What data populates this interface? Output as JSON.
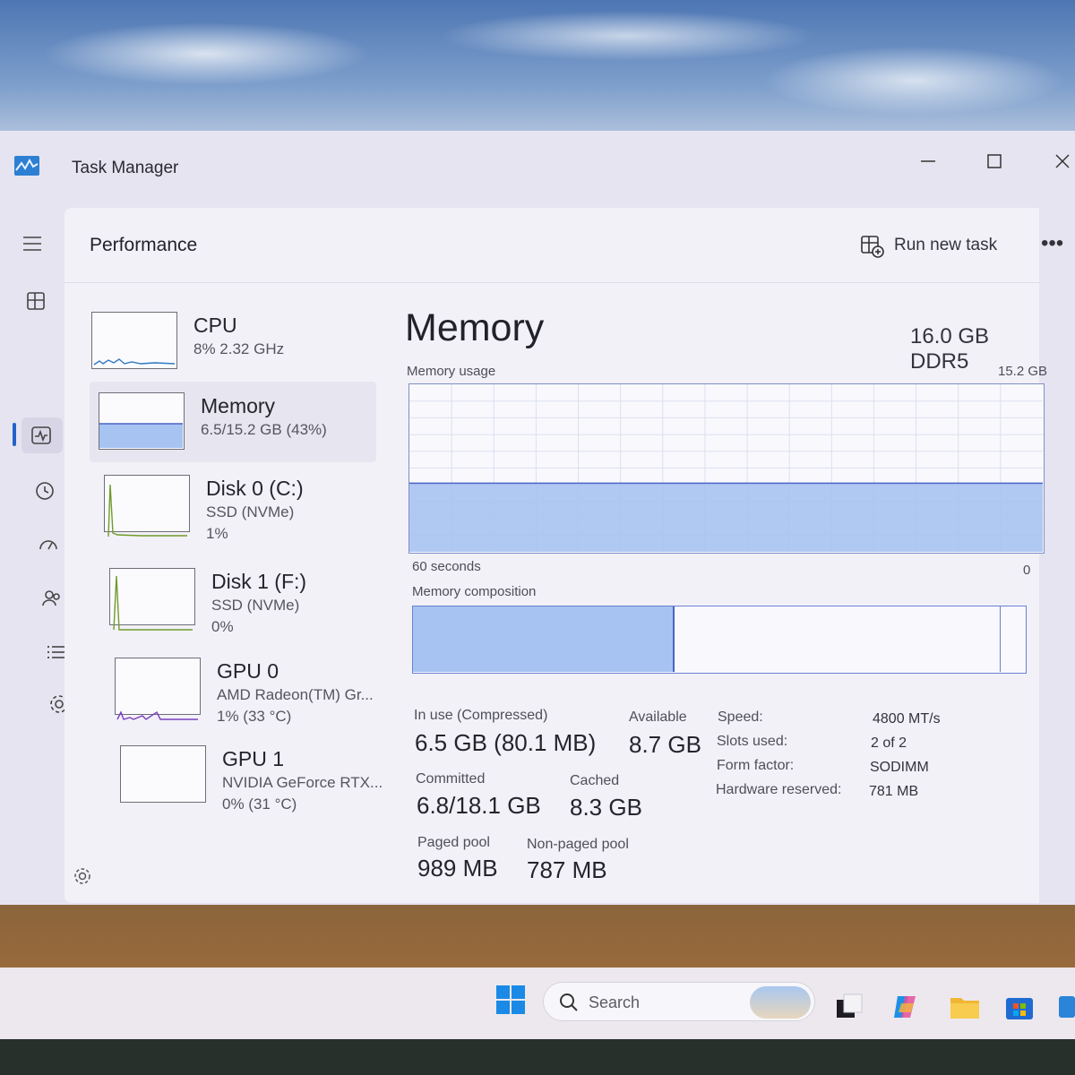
{
  "window": {
    "title": "Task Manager",
    "minimize_icon": "minimize-icon",
    "maximize_icon": "maximize-icon",
    "close_icon": "close-icon"
  },
  "nav": {
    "items": [
      {
        "icon": "hamburger-menu-icon"
      },
      {
        "icon": "processes-icon"
      },
      {
        "icon": "performance-icon",
        "active": true
      },
      {
        "icon": "app-history-icon"
      },
      {
        "icon": "startup-apps-icon"
      },
      {
        "icon": "users-icon"
      },
      {
        "icon": "details-icon"
      },
      {
        "icon": "services-icon"
      }
    ],
    "settings_icon": "settings-icon"
  },
  "header": {
    "title": "Performance",
    "run_new_task": "Run new task",
    "more": "•••"
  },
  "devices": [
    {
      "name": "CPU",
      "line1": "8% 2.32 GHz",
      "line2": "",
      "color": "#2f78c2"
    },
    {
      "name": "Memory",
      "line1": "6.5/15.2 GB (43%)",
      "line2": "",
      "color": "#5f73c9",
      "selected": true
    },
    {
      "name": "Disk 0 (C:)",
      "line1": "SSD (NVMe)",
      "line2": "1%",
      "color": "#6f9b2a"
    },
    {
      "name": "Disk 1 (F:)",
      "line1": "SSD (NVMe)",
      "line2": "0%",
      "color": "#6f9b2a"
    },
    {
      "name": "GPU 0",
      "line1": "AMD Radeon(TM) Gr...",
      "line2": "1% (33 °C)",
      "color": "#7a3fbf"
    },
    {
      "name": "GPU 1",
      "line1": "NVIDIA GeForce RTX...",
      "line2": "0% (31 °C)",
      "color": "#7a3fbf"
    }
  ],
  "memory": {
    "title": "Memory",
    "total": "16.0 GB DDR5",
    "usage_label": "Memory usage",
    "usage_max": "15.2 GB",
    "time_label": "60 seconds",
    "time_end": "0",
    "composition_label": "Memory composition",
    "usage_fraction": 0.41,
    "composition": {
      "in_use_fraction": 0.427,
      "standby_fraction": 0.96
    },
    "stats": {
      "in_use_label": "In use (Compressed)",
      "in_use_value": "6.5 GB (80.1 MB)",
      "available_label": "Available",
      "available_value": "8.7 GB",
      "committed_label": "Committed",
      "committed_value": "6.8/18.1 GB",
      "cached_label": "Cached",
      "cached_value": "8.3 GB",
      "paged_label": "Paged pool",
      "paged_value": "989 MB",
      "nonpaged_label": "Non-paged pool",
      "nonpaged_value": "787 MB"
    },
    "specs": {
      "speed_label": "Speed:",
      "speed_value": "4800 MT/s",
      "slots_label": "Slots used:",
      "slots_value": "2 of 2",
      "form_label": "Form factor:",
      "form_value": "SODIMM",
      "reserved_label": "Hardware reserved:",
      "reserved_value": "781 MB"
    }
  },
  "taskbar": {
    "search_placeholder": "Search",
    "apps": [
      "task-view-icon",
      "copilot-icon",
      "file-explorer-icon",
      "microsoft-store-icon",
      "photos-icon"
    ]
  },
  "colors": {
    "accent": "#2363c9",
    "memory_fill": "#a7c3f2",
    "memory_line": "#4a64c4"
  }
}
